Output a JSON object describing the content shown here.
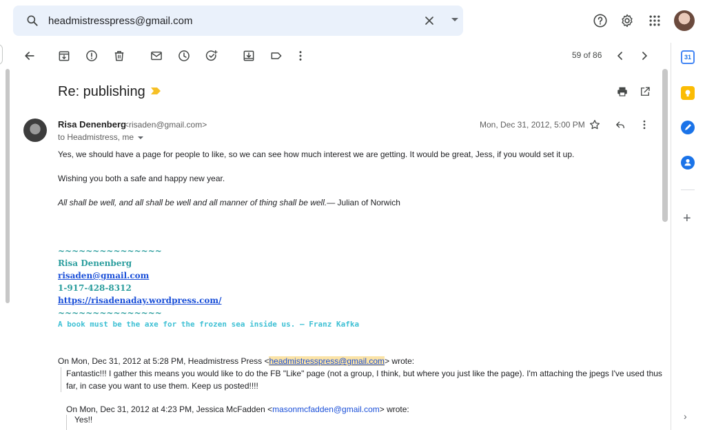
{
  "search": {
    "value": "headmistresspress@gmail.com"
  },
  "toolbar": {
    "pager": "59 of 86"
  },
  "email": {
    "subject": "Re: publishing",
    "sender_name": "Risa Denenberg",
    "sender_email": "<risaden@gmail.com>",
    "recipients": "to Headmistress, me",
    "date": "Mon, Dec 31, 2012, 5:00 PM",
    "body": [
      "Yes, we should have a page for people to like, so we can see how much interest we are getting. It would be great, Jess, if you would set it up.",
      "Wishing you both a safe and happy new year."
    ],
    "quote_italic": "All shall be well, and all shall be well and all manner of thing shall be well.",
    "quote_attrib": "— Julian of Norwich",
    "signature": {
      "tildes": "~~~~~~~~~~~~~~~",
      "name": "Risa Denenberg",
      "email": "risaden@gmail.com",
      "phone": "1-917-428-8312",
      "url": "https://risadenaday.wordpress.com/",
      "tildes2": "~~~~~~~~~~~~~~~",
      "quote": "A book must be the axe for the frozen sea inside us.  — Franz Kafka"
    },
    "quoted": {
      "header_pre": "On Mon, Dec 31, 2012 at 5:28 PM, Headmistress Press <",
      "header_email": "headmistresspress@gmail.com",
      "header_post": "> wrote:",
      "text_line1": "Fantastic!!! I gather this means you would like to do the FB \"Like\" page (not a group, I think, but where you just like the page). I'm attaching the jpegs I've used thus",
      "text_line2": "far, in case you want to use them. Keep us posted!!!!",
      "header2_pre": "On Mon, Dec 31, 2012 at 4:23 PM, Jessica McFadden <",
      "header2_email": "masonmcfadden@gmail.com",
      "header2_post": "> wrote:",
      "text2": "Yes!!"
    }
  },
  "side_panel": {
    "calendar_day": "31"
  },
  "colors": {
    "search_bg": "#eaf1fb",
    "label_yellow": "#f6c026",
    "signature_teal": "#2a9d9d",
    "signature_link": "#1a4fd8",
    "highlight": "#fbe3a6"
  }
}
